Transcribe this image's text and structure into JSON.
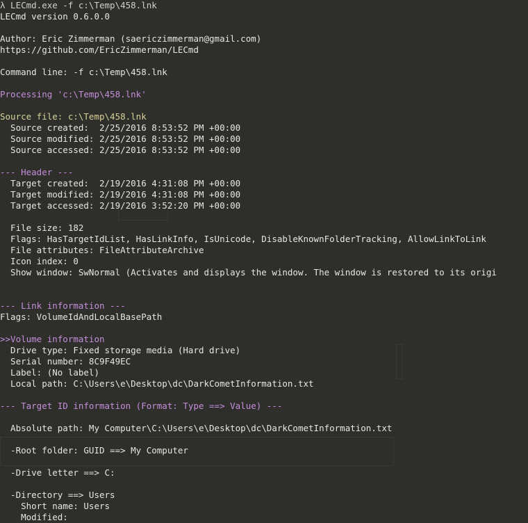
{
  "colors": {
    "background": "#2e2e2b",
    "text": "#e6e6e6",
    "section": "#c58fdb",
    "source": "#d7d39a"
  },
  "lines": [
    {
      "text": "λ LECmd.exe -f c:\\Temp\\458.lnk",
      "style": "prompt"
    },
    {
      "text": "LECmd version 0.6.0.0",
      "style": "normal"
    },
    {
      "text": "",
      "style": "normal"
    },
    {
      "text": "Author: Eric Zimmerman (saericzimmerman@gmail.com)",
      "style": "normal"
    },
    {
      "text": "https://github.com/EricZimmerman/LECmd",
      "style": "normal"
    },
    {
      "text": "",
      "style": "normal"
    },
    {
      "text": "Command line: -f c:\\Temp\\458.lnk",
      "style": "normal"
    },
    {
      "text": "",
      "style": "normal"
    },
    {
      "text": "Processing 'c:\\Temp\\458.lnk'",
      "style": "purple"
    },
    {
      "text": "",
      "style": "normal"
    },
    {
      "text": "Source file: c:\\Temp\\458.lnk",
      "style": "yellow"
    },
    {
      "text": "  Source created:  2/25/2016 8:53:52 PM +00:00",
      "style": "normal"
    },
    {
      "text": "  Source modified: 2/25/2016 8:53:52 PM +00:00",
      "style": "normal"
    },
    {
      "text": "  Source accessed: 2/25/2016 8:53:52 PM +00:00",
      "style": "normal"
    },
    {
      "text": "",
      "style": "normal"
    },
    {
      "text": "--- Header ---",
      "style": "purple"
    },
    {
      "text": "  Target created:  2/19/2016 4:31:08 PM +00:00",
      "style": "normal"
    },
    {
      "text": "  Target modified: 2/19/2016 4:31:08 PM +00:00",
      "style": "normal"
    },
    {
      "text": "  Target accessed: 2/19/2016 3:52:20 PM +00:00",
      "style": "normal"
    },
    {
      "text": "",
      "style": "normal"
    },
    {
      "text": "  File size: 182",
      "style": "normal"
    },
    {
      "text": "  Flags: HasTargetIdList, HasLinkInfo, IsUnicode, DisableKnownFolderTracking, AllowLinkToLink",
      "style": "normal"
    },
    {
      "text": "  File attributes: FileAttributeArchive",
      "style": "normal"
    },
    {
      "text": "  Icon index: 0",
      "style": "normal"
    },
    {
      "text": "  Show window: SwNormal (Activates and displays the window. The window is restored to its origi",
      "style": "normal"
    },
    {
      "text": "",
      "style": "normal"
    },
    {
      "text": "",
      "style": "normal"
    },
    {
      "text": "--- Link information ---",
      "style": "purple"
    },
    {
      "text": "Flags: VolumeIdAndLocalBasePath",
      "style": "normal"
    },
    {
      "text": "",
      "style": "normal"
    },
    {
      "text": ">>Volume information",
      "style": "purple"
    },
    {
      "text": "  Drive type: Fixed storage media (Hard drive)",
      "style": "normal"
    },
    {
      "text": "  Serial number: 8C9F49EC",
      "style": "normal"
    },
    {
      "text": "  Label: (No label)",
      "style": "normal"
    },
    {
      "text": "  Local path: C:\\Users\\e\\Desktop\\dc\\DarkCometInformation.txt",
      "style": "normal"
    },
    {
      "text": "",
      "style": "normal"
    },
    {
      "text": "--- Target ID information (Format: Type ==> Value) ---",
      "style": "purple"
    },
    {
      "text": "",
      "style": "normal"
    },
    {
      "text": "  Absolute path: My Computer\\C:\\Users\\e\\Desktop\\dc\\DarkCometInformation.txt",
      "style": "normal"
    },
    {
      "text": "",
      "style": "normal"
    },
    {
      "text": "  -Root folder: GUID ==> My Computer",
      "style": "normal"
    },
    {
      "text": "",
      "style": "normal"
    },
    {
      "text": "  -Drive letter ==> C:",
      "style": "normal"
    },
    {
      "text": "",
      "style": "normal"
    },
    {
      "text": "  -Directory ==> Users",
      "style": "normal"
    },
    {
      "text": "    Short name: Users",
      "style": "normal"
    },
    {
      "text": "    Modified:",
      "style": "normal"
    }
  ]
}
